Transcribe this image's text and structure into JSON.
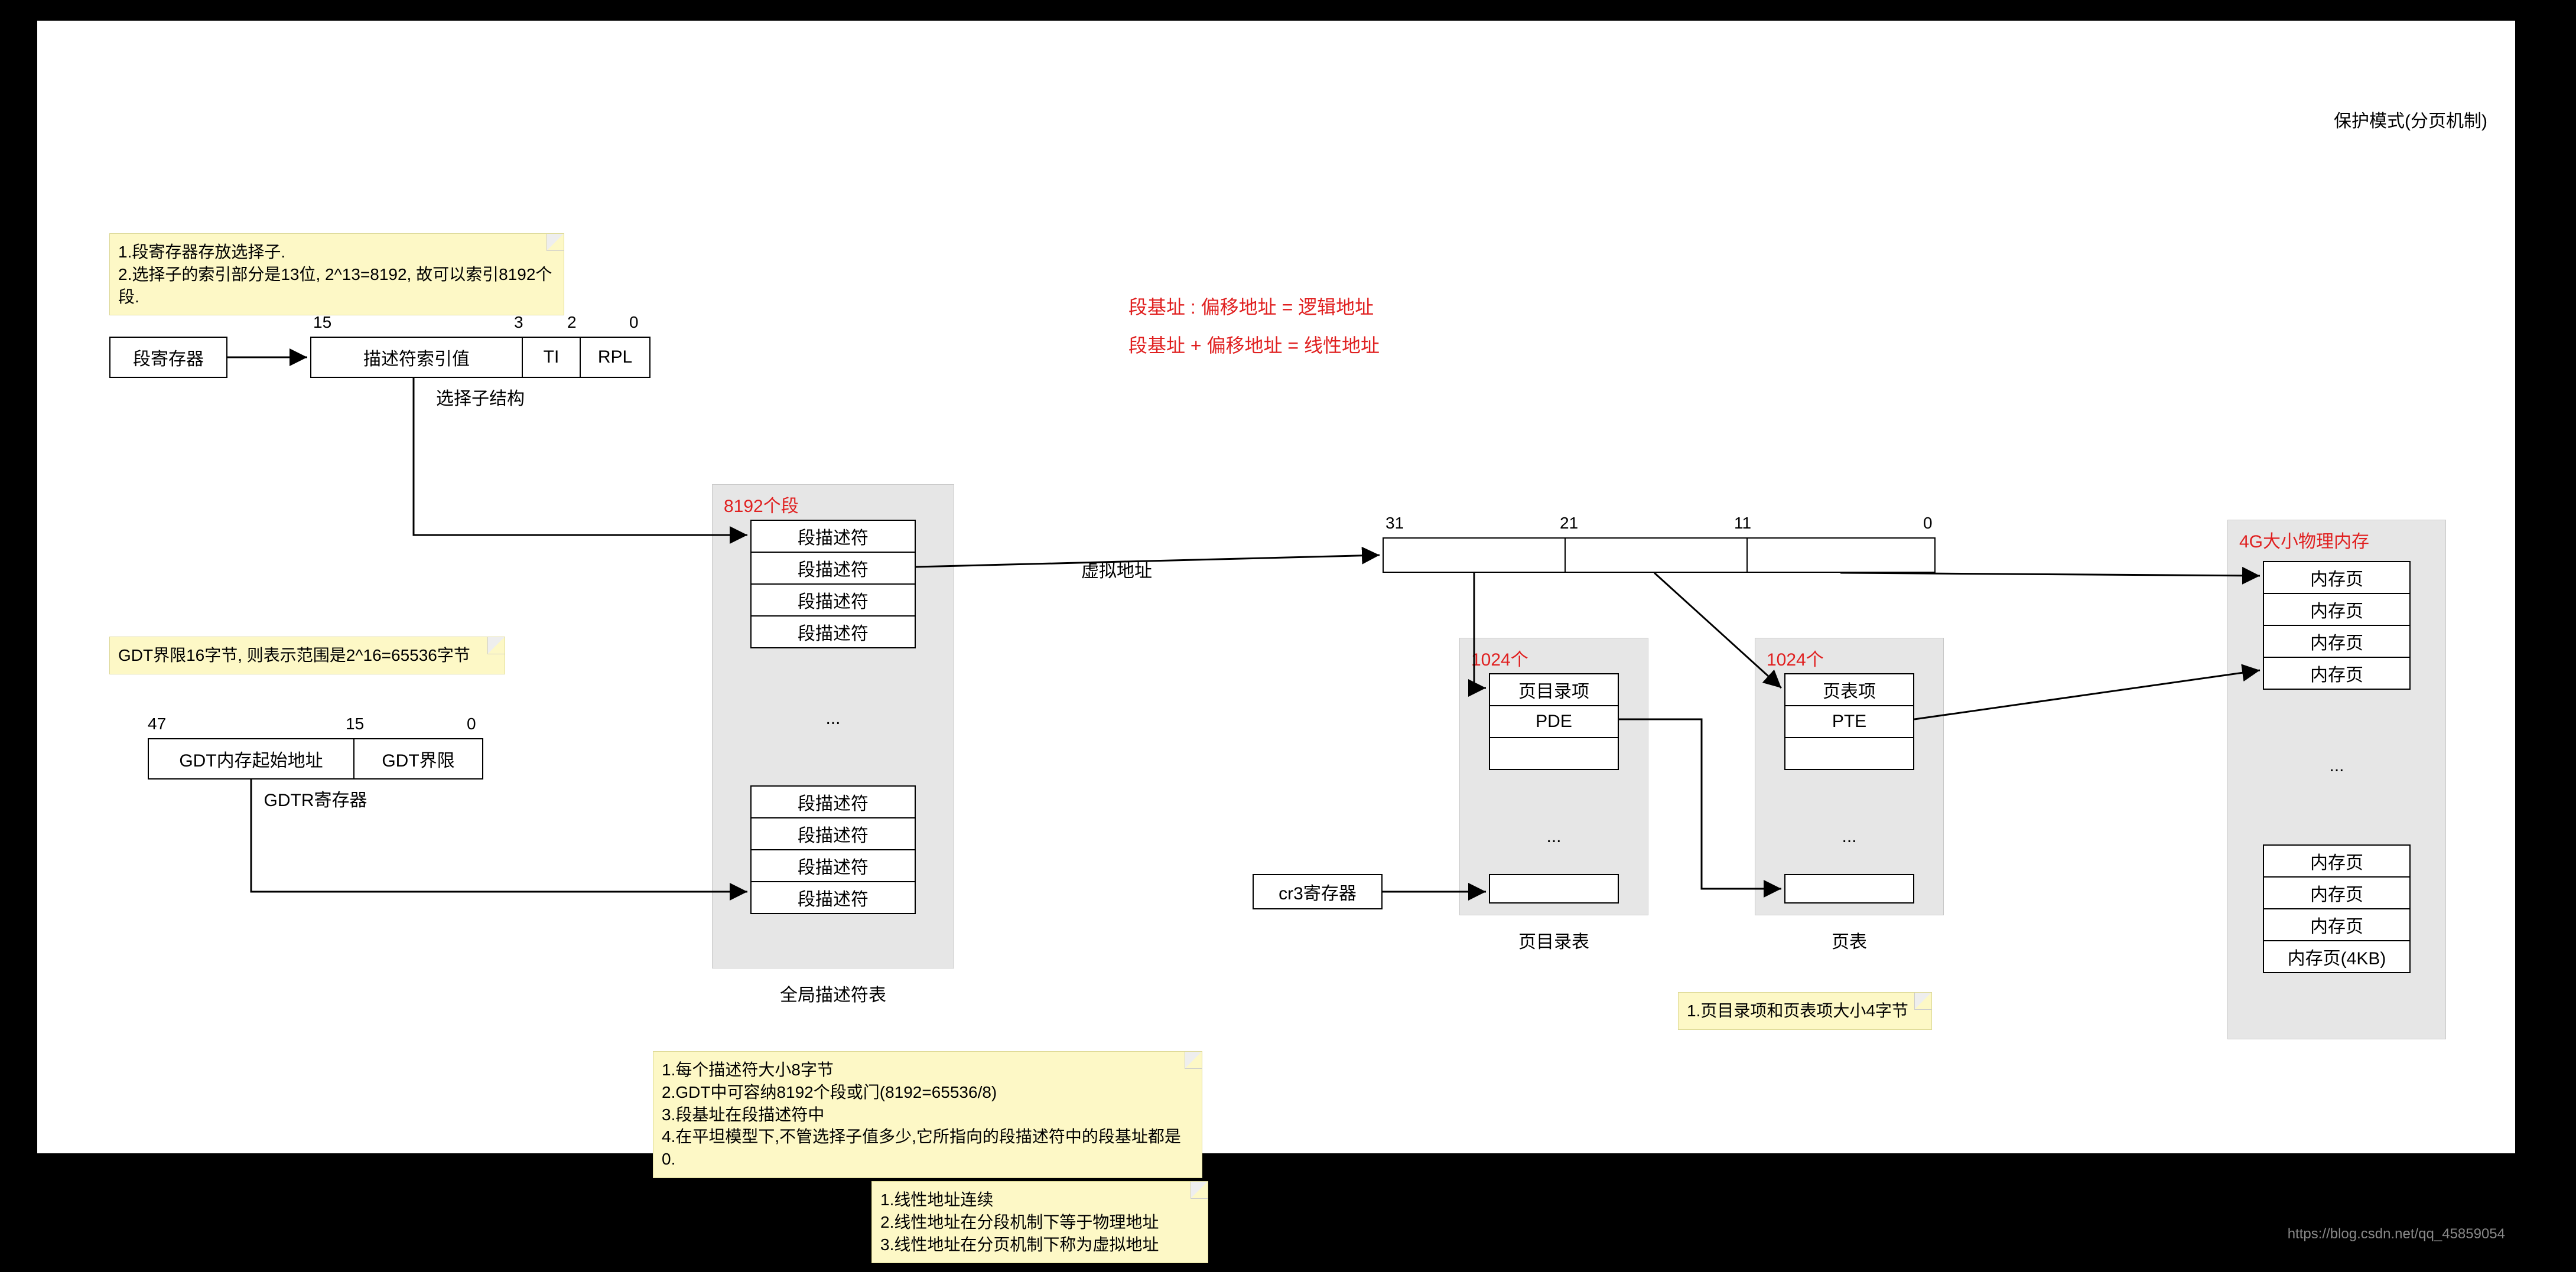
{
  "title_top_right": "保护模式(分页机制)",
  "footer": "https://blog.csdn.net/qq_45859054",
  "note_selector": {
    "l1": "1.段寄存器存放选择子.",
    "l2": "2.选择子的索引部分是13位, 2^13=8192, 故可以索引8192个段."
  },
  "seg_register": "段寄存器",
  "selector": {
    "index": "描述符索引值",
    "ti": "TI",
    "rpl": "RPL",
    "ticks": {
      "b15": "15",
      "b3": "3",
      "b2": "2",
      "b0": "0"
    },
    "caption": "选择子结构"
  },
  "note_gdtlimit": "GDT界限16字节, 则表示范围是2^16=65536字节",
  "gdtr": {
    "base": "GDT内存起始地址",
    "limit": "GDT界限",
    "ticks": {
      "b47": "47",
      "b15": "15",
      "b0": "0"
    },
    "caption": "GDTR寄存器"
  },
  "gdt_area": {
    "title_red": "8192个段",
    "rows_top": [
      "段描述符",
      "段描述符",
      "段描述符",
      "段描述符"
    ],
    "dots": "...",
    "rows_bot": [
      "段描述符",
      "段描述符",
      "段描述符",
      "段描述符"
    ],
    "caption": "全局描述符表"
  },
  "note_desc": {
    "l1": "1.每个描述符大小8字节",
    "l2": "2.GDT中可容纳8192个段或门(8192=65536/8)",
    "l3": "3.段基址在段描述符中",
    "l4": "4.在平坦模型下,不管选择子值多少,它所指向的段描述符中的段基址都是0."
  },
  "note_linear": {
    "l1": "1.线性地址连续",
    "l2": "2.线性地址在分段机制下等于物理地址",
    "l3": "3.线性地址在分页机制下称为虚拟地址"
  },
  "red_eq_1": "段基址 : 偏移地址  =  逻辑地址",
  "red_eq_2": "段基址 + 偏移地址  =  线性地址",
  "va_label": "虚拟地址",
  "linear32": {
    "ticks": {
      "b31": "31",
      "b21": "21",
      "b11": "11",
      "b0": "0"
    }
  },
  "pde_area": {
    "title_red": "1024个",
    "rows": [
      "页目录项",
      "PDE",
      ""
    ],
    "dots": "...",
    "caption": "页目录表"
  },
  "pte_area": {
    "title_red": "1024个",
    "rows": [
      "页表项",
      "PTE",
      ""
    ],
    "dots": "...",
    "caption": "页表"
  },
  "cr3": "cr3寄存器",
  "note_entry": "1.页目录项和页表项大小4字节",
  "phys": {
    "title_red": "4G大小物理内存",
    "rows_top": [
      "内存页",
      "内存页",
      "内存页",
      "内存页"
    ],
    "dots": "...",
    "rows_bot": [
      "内存页",
      "内存页",
      "内存页",
      "内存页(4KB)"
    ],
    "caption": ""
  }
}
